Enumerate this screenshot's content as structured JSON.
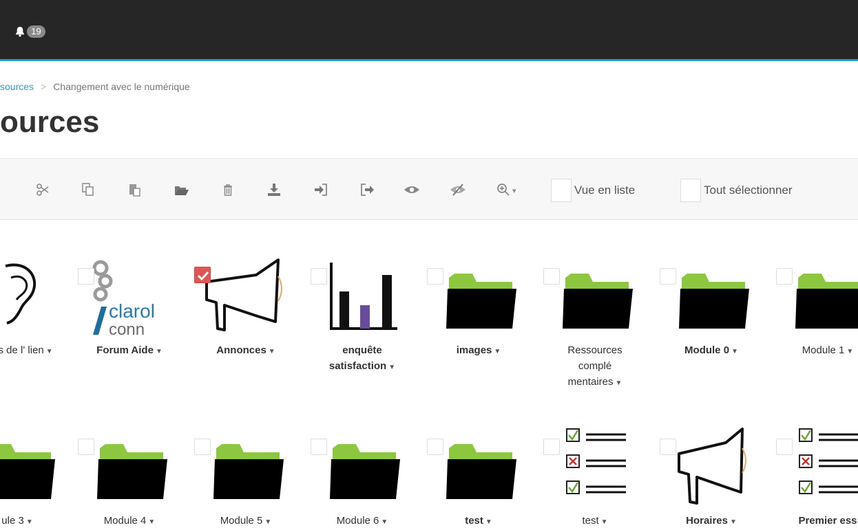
{
  "topbar": {
    "notification_count": "19",
    "bell_icon": "bell-icon"
  },
  "breadcrumb": {
    "root": "sources",
    "separator": ">",
    "current": "Changement avec le numérique"
  },
  "page_title": "ources",
  "toolbar": {
    "buttons": [
      "scissors-icon",
      "copy-icon",
      "paste-icon",
      "folder-open-icon",
      "trash-icon",
      "download-icon",
      "sign-in-icon",
      "sign-out-icon",
      "eye-icon",
      "eye-slash-icon",
      "zoom-in-icon"
    ],
    "list_view_label": "Vue en liste",
    "select_all_label": "Tout sélectionner"
  },
  "row1": [
    {
      "name_lines": [
        "ases de l'",
        "lien"
      ],
      "icon": "ear-icon",
      "bold": false
    },
    {
      "name_lines": [
        "Forum Aide"
      ],
      "icon": "claroline-connect-logo",
      "bold": true,
      "logo_text": [
        "clarol",
        "conn"
      ]
    },
    {
      "name_lines": [
        "Annonces"
      ],
      "icon": "megaphone-icon",
      "bold": true,
      "checked": true
    },
    {
      "name_lines": [
        "enquête",
        "satisfaction"
      ],
      "icon": "bar-chart-icon",
      "bold": true
    },
    {
      "name_lines": [
        "images"
      ],
      "icon": "folder-icon",
      "bold": true
    },
    {
      "name_lines": [
        "Ressources",
        "complé",
        "mentaires"
      ],
      "icon": "folder-icon",
      "bold": false
    },
    {
      "name_lines": [
        "Module 0"
      ],
      "icon": "folder-icon",
      "bold": true
    },
    {
      "name_lines": [
        "Module 1"
      ],
      "icon": "folder-icon",
      "bold": false
    }
  ],
  "row2": [
    {
      "name_lines": [
        "ule 3"
      ],
      "icon": "folder-icon",
      "bold": false
    },
    {
      "name_lines": [
        "Module 4"
      ],
      "icon": "folder-icon",
      "bold": false
    },
    {
      "name_lines": [
        "Module 5"
      ],
      "icon": "folder-icon",
      "bold": false
    },
    {
      "name_lines": [
        "Module 6"
      ],
      "icon": "folder-icon",
      "bold": false
    },
    {
      "name_lines": [
        "test"
      ],
      "icon": "folder-icon",
      "bold": true
    },
    {
      "name_lines": [
        "test"
      ],
      "icon": "checklist-icon",
      "bold": false
    },
    {
      "name_lines": [
        "Horaires"
      ],
      "icon": "megaphone-icon",
      "bold": true
    },
    {
      "name_lines": [
        "Premier ess"
      ],
      "icon": "checklist-icon",
      "bold": true
    }
  ],
  "colors": {
    "accent": "#2a9fd6",
    "topbar": "#262626",
    "folder_tab": "#8dc63f",
    "check_red": "#e05555",
    "chart_bar": "#6a4c9c"
  }
}
